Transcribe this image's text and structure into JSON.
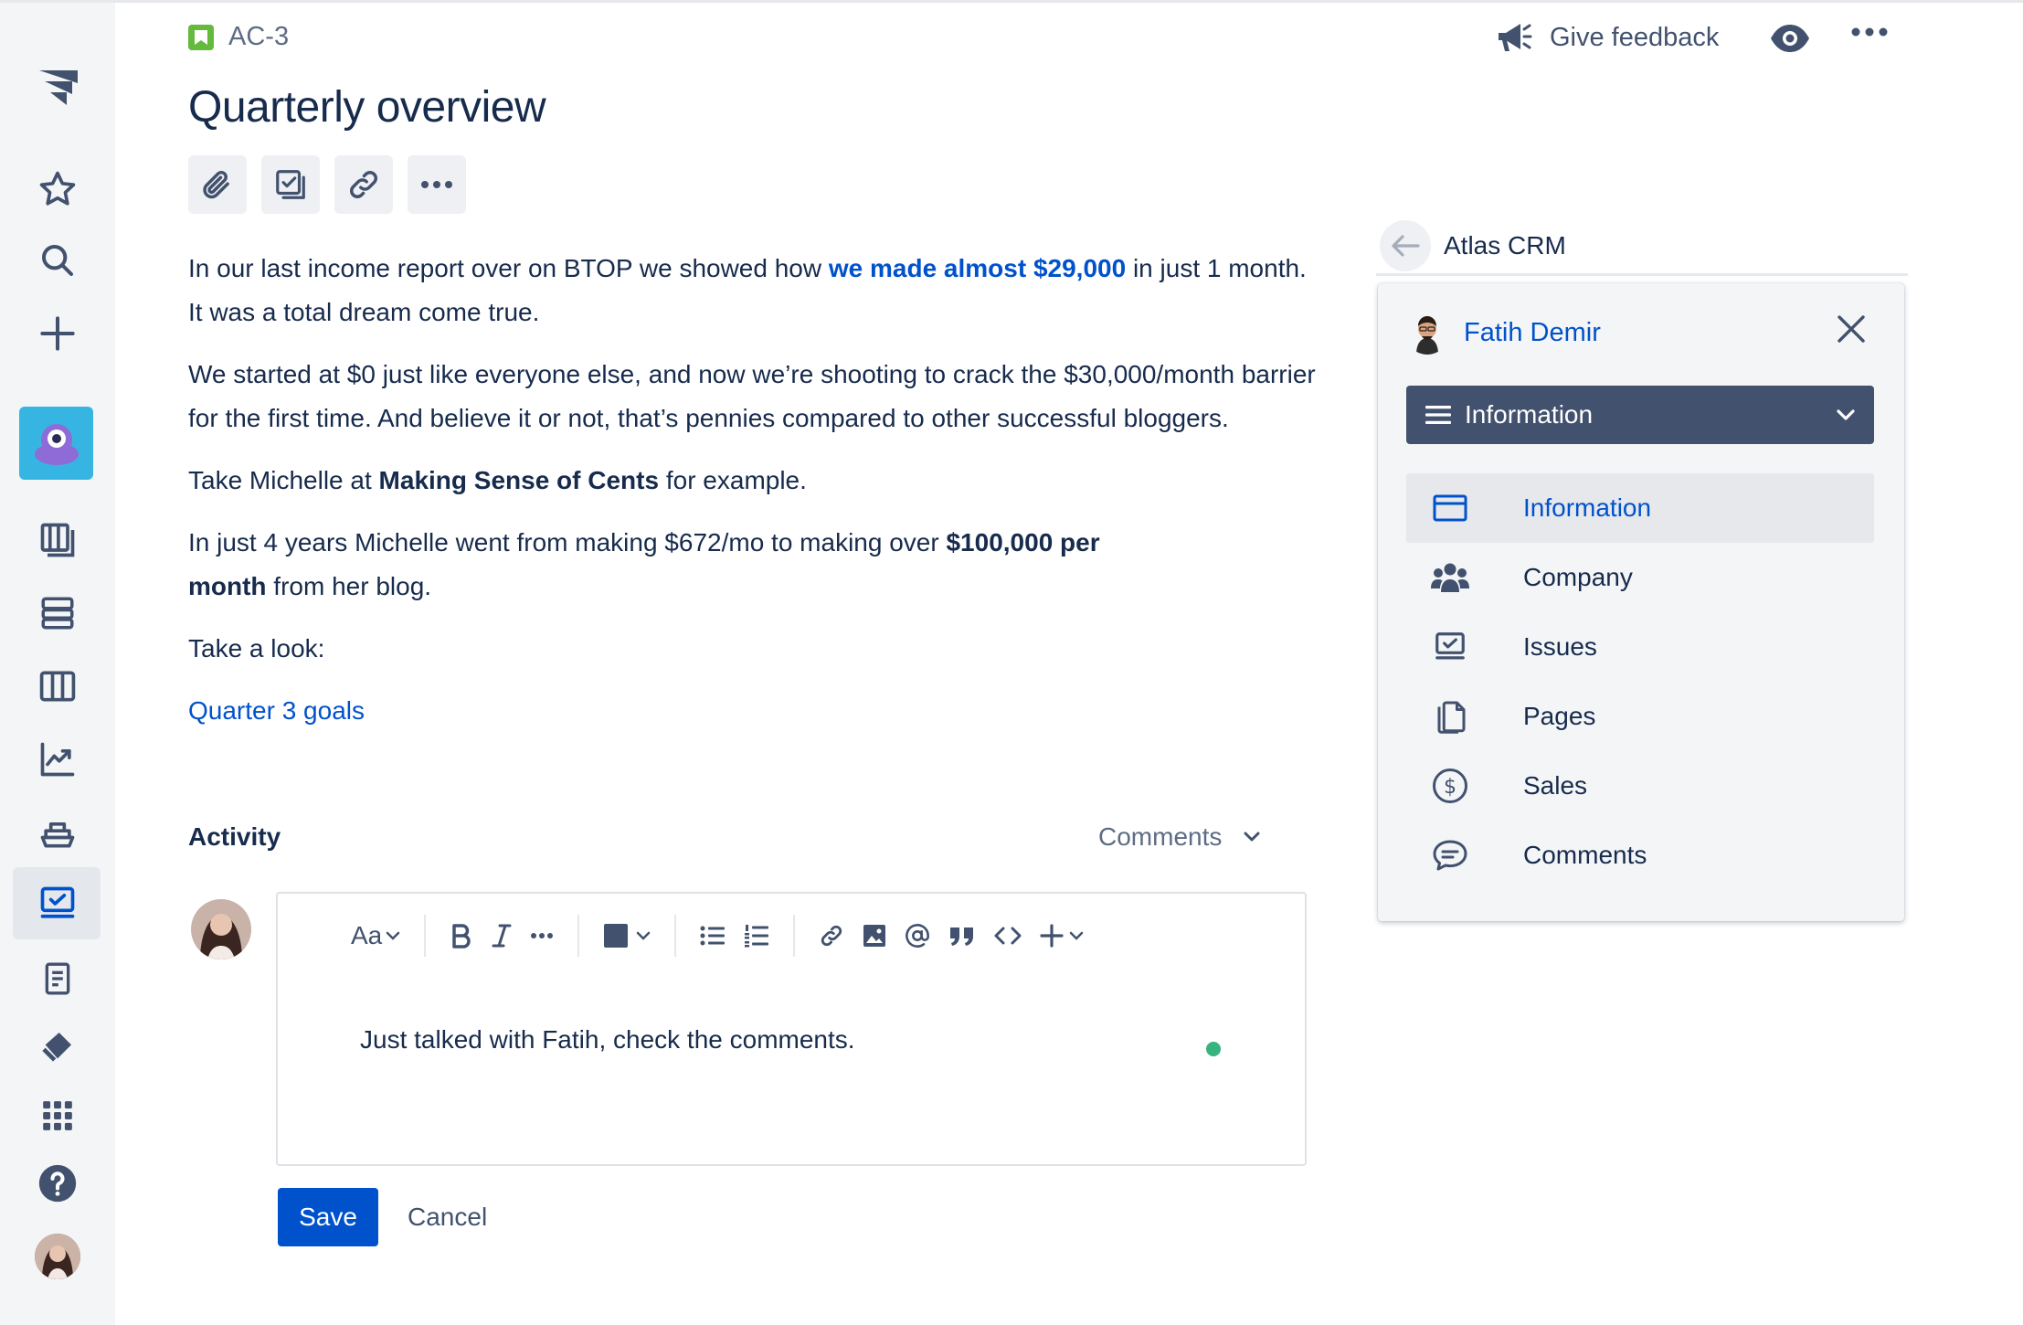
{
  "issue": {
    "key": "AC-3",
    "title": "Quarterly overview"
  },
  "header": {
    "feedback_label": "Give feedback"
  },
  "description": {
    "p1_a": "In our last income report over on BTOP we showed how ",
    "p1_link": "we made almost $29,000",
    "p1_b": " in just 1 month. It was a total dream come true.",
    "p2": "We started at $0 just like everyone else, and now we’re shooting to crack the $30,000/month barrier for the first time. And believe it or not, that’s pennies compared to other successful bloggers.",
    "p3_a": "Take Michelle at ",
    "p3_bold": "Making Sense of Cents",
    "p3_b": " for example.",
    "p4_a": "In just 4 years Michelle went from making $672/mo to making over ",
    "p4_bold": "$100,000 per month",
    "p4_b": " from her blog.",
    "p5": "Take a look:",
    "link": "Quarter 3 goals"
  },
  "activity": {
    "label": "Activity",
    "filter": "Comments",
    "editor_text": "Just talked with Fatih, check the comments.",
    "toolbar_text_style": "Aa",
    "save_label": "Save",
    "cancel_label": "Cancel"
  },
  "crm": {
    "title": "Atlas CRM",
    "contact_name": "Fatih Demir",
    "selected_section": "Information",
    "menu": [
      {
        "label": "Information",
        "icon": "id-card-icon",
        "active": true
      },
      {
        "label": "Company",
        "icon": "people-group-icon"
      },
      {
        "label": "Issues",
        "icon": "issues-icon"
      },
      {
        "label": "Pages",
        "icon": "pages-icon"
      },
      {
        "label": "Sales",
        "icon": "dollar-icon"
      },
      {
        "label": "Comments",
        "icon": "comment-icon"
      }
    ]
  },
  "colors": {
    "accent": "#0052cc",
    "sidebar_bg": "#f4f5f7",
    "project_tile": "#36b5e3",
    "presence": "#36b37e",
    "select_bg": "#42526e"
  }
}
